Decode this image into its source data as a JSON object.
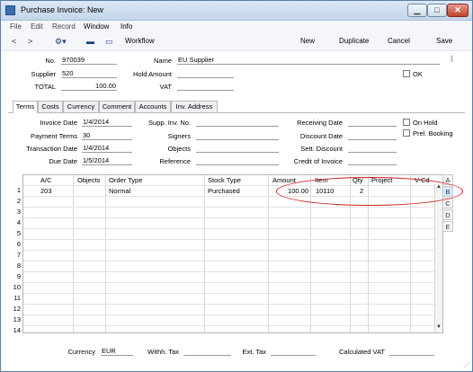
{
  "window": {
    "title": "Purchase Invoice: New",
    "controls": {
      "minimize": "▁",
      "maximize": "□",
      "close": "✕"
    }
  },
  "menu": [
    "File",
    "Edit",
    "Record",
    "Window",
    "Info"
  ],
  "toolbar": {
    "back": "<",
    "forward": ">",
    "gear": "⚙▾",
    "print": "▬",
    "preview": "▭",
    "workflow": "Workflow",
    "new": "New",
    "duplicate": "Duplicate",
    "cancel": "Cancel",
    "save": "Save"
  },
  "header": {
    "no_label": "No.",
    "no_value": "970039",
    "name_label": "Name",
    "name_value": "EU Supplier",
    "supplier_label": "Supplier",
    "supplier_value": "520",
    "hold_amount_label": "Hold Amount",
    "hold_amount_value": "",
    "ok_label": "OK",
    "total_label": "TOTAL",
    "total_value": "100.00",
    "vat_label": "VAT",
    "vat_value": ""
  },
  "tabs": [
    "Terms",
    "Costs",
    "Currency",
    "Comment",
    "Accounts",
    "Inv. Address"
  ],
  "terms": {
    "invoice_date_label": "Invoice Date",
    "invoice_date_value": "1/4/2014",
    "payment_terms_label": "Payment Terms",
    "payment_terms_value": "30",
    "transaction_date_label": "Transaction Date",
    "transaction_date_value": "1/4/2014",
    "due_date_label": "Due Date",
    "due_date_value": "1/5/2014",
    "supp_inv_no_label": "Supp. Inv. No.",
    "supp_inv_no_value": "",
    "signers_label": "Signers",
    "signers_value": "",
    "objects_label": "Objects",
    "objects_value": "",
    "reference_label": "Reference",
    "reference_value": "",
    "receiving_date_label": "Receiving Date",
    "receiving_date_value": "",
    "discount_date_label": "Discount Date",
    "discount_date_value": "",
    "sett_discount_label": "Sett. Discount",
    "sett_discount_value": "",
    "credit_of_invoice_label": "Credit of Invoice",
    "credit_of_invoice_value": "",
    "on_hold_label": "On Hold",
    "prel_booking_label": "Prel. Booking"
  },
  "grid": {
    "columns": [
      "A/C",
      "Objects",
      "Order Type",
      "Stock Type",
      "Amount",
      "Item",
      "Qty",
      "Project",
      "V-Cd"
    ],
    "rows": [
      {
        "num": "1",
        "ac": "203",
        "objects": "",
        "order_type": "Normal",
        "stock_type": "Purchased",
        "amount": "100.00",
        "item": "10110",
        "qty": "2",
        "project": "",
        "vcd": ""
      }
    ],
    "row_numbers": [
      "1",
      "2",
      "3",
      "4",
      "5",
      "6",
      "7",
      "8",
      "9",
      "10",
      "11",
      "12",
      "13",
      "14"
    ],
    "scroll_up": "▲",
    "scroll_down": "▼"
  },
  "cards": [
    "A",
    "B",
    "C",
    "D",
    "E"
  ],
  "footer": {
    "currency_label": "Currency",
    "currency_value": "EUR",
    "withh_tax_label": "Withh. Tax",
    "withh_tax_value": "",
    "ext_tax_label": "Ext. Tax",
    "ext_tax_value": "",
    "calc_vat_label": "Calculated VAT",
    "calc_vat_value": ""
  },
  "colors": {
    "highlight": "#d21e1e",
    "title_bar": "#c4d6ea",
    "accent": "#3a6fb0"
  }
}
